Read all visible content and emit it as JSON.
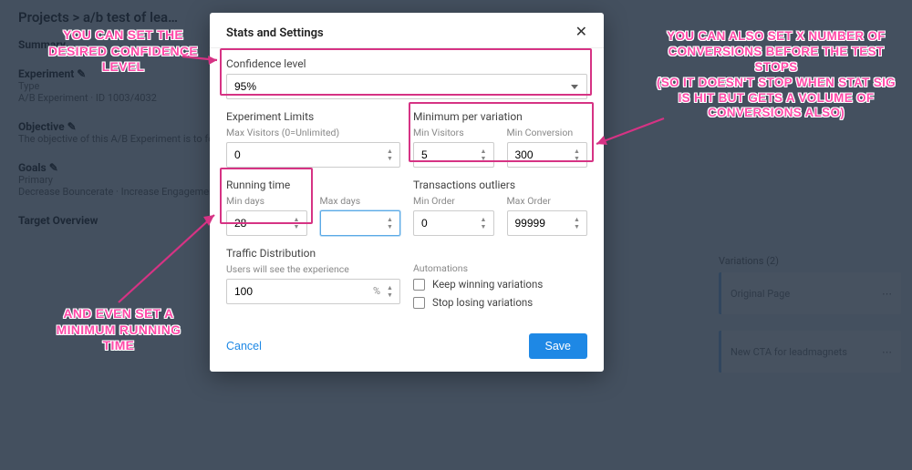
{
  "background": {
    "breadcrumb": "Projects  >  a/b test of lea…",
    "summary_label": "Summary",
    "experiment_label": "Experiment  ✎",
    "type_label": "Type",
    "type_value": "A/B Experiment · ID 1003/4032",
    "objective_label": "Objective  ✎",
    "objective_text": "The objective of this A/B Experiment is to focus…",
    "goals_label": "Goals  ✎",
    "goals_primary": "Primary",
    "goals_values": "Decrease Bouncerate   ·   Increase Engagement",
    "target_label": "Target Overview",
    "side_header": "Variations (2)",
    "card1": "Original Page",
    "card2": "New CTA for leadmagnets"
  },
  "modal": {
    "title": "Stats and Settings",
    "confidence": {
      "label": "Confidence level",
      "value": "95%"
    },
    "limits": {
      "label": "Experiment Limits",
      "maxVisitorsLabel": "Max Visitors (0=Unlimited)",
      "maxVisitors": "0"
    },
    "minVar": {
      "label": "Minimum per variation",
      "minVisitorsLabel": "Min Visitors",
      "minVisitors": "5",
      "minConvLabel": "Min Conversion",
      "minConversion": "300"
    },
    "running": {
      "label": "Running time",
      "minDaysLabel": "Min days",
      "minDays": "28",
      "maxDaysLabel": "Max days",
      "maxDays": ""
    },
    "outliers": {
      "label": "Transactions outliers",
      "minOrderLabel": "Min Order",
      "minOrder": "0",
      "maxOrderLabel": "Max Order",
      "maxOrder": "99999"
    },
    "traffic": {
      "label": "Traffic Distribution",
      "sub": "Users will see the experience",
      "percent": "100"
    },
    "automations": {
      "label": "Automations",
      "keep": "Keep winning variations",
      "stop": "Stop losing variations"
    },
    "cancel": "Cancel",
    "save": "Save"
  },
  "annotations": {
    "a1": "YOU CAN SET THE DESIRED CONFIDENCE LEVEL",
    "a2": "AND EVEN SET A MINIMUM RUNNING TIME",
    "a3": "YOU CAN ALSO SET X NUMBER OF CONVERSIONS BEFORE THE TEST STOPS\n(SO IT DOESN'T STOP WHEN STAT SIG IS HIT BUT GETS A VOLUME OF CONVERSIONS ALSO)"
  }
}
